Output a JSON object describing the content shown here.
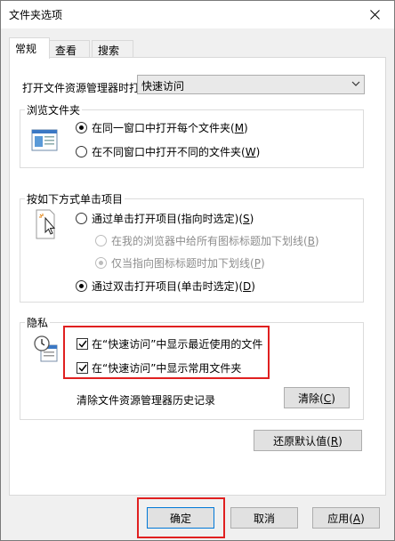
{
  "window": {
    "title": "文件夹选项",
    "close_label": "✕"
  },
  "tabs": [
    {
      "label": "常规"
    },
    {
      "label": "查看"
    },
    {
      "label": "搜索"
    }
  ],
  "open_explorer": {
    "label": "打开文件资源管理器时打",
    "selected": "快速访问"
  },
  "browse_folders": {
    "legend": "浏览文件夹",
    "option_same": {
      "text": "在同一窗口中打开每个文件夹(",
      "key": "M",
      "end": ")"
    },
    "option_diff": {
      "text": "在不同窗口中打开不同的文件夹(",
      "key": "W",
      "end": ")"
    }
  },
  "click_items": {
    "legend": "按如下方式单击项目",
    "single": {
      "text": "通过单击打开项目(指向时选定)(",
      "key": "S",
      "end": ")"
    },
    "underline_all": {
      "text": "在我的浏览器中给所有图标标题加下划线(",
      "key": "B",
      "end": ")"
    },
    "underline_point": {
      "text": "仅当指向图标标题时加下划线(",
      "key": "P",
      "end": ")"
    },
    "double": {
      "text": "通过双击打开项目(单击时选定)(",
      "key": "D",
      "end": ")"
    }
  },
  "privacy": {
    "legend": "隐私",
    "recent_files": "在“快速访问”中显示最近使用的文件",
    "frequent_folders": "在“快速访问”中显示常用文件夹",
    "clear_label": "清除文件资源管理器历史记录",
    "clear_button": {
      "text": "清除(",
      "key": "C",
      "end": ")"
    }
  },
  "restore_button": {
    "text": "还原默认值(",
    "key": "R",
    "end": ")"
  },
  "footer": {
    "ok": "确定",
    "cancel": "取消",
    "apply": {
      "text": "应用(",
      "key": "A",
      "end": ")"
    }
  },
  "colors": {
    "highlight": "#e02020",
    "accent": "#0078d7"
  }
}
